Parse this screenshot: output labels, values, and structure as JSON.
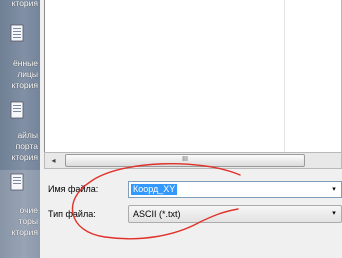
{
  "places": [
    {
      "label": "ктория",
      "icon": "folder-icon"
    },
    {
      "label": "ённые\nлицы\nктория",
      "icon": "document-icon"
    },
    {
      "label": "айлы\nпорта\nктория",
      "icon": "document-icon"
    },
    {
      "label": "очие\nторы\nктория",
      "icon": "document-icon"
    }
  ],
  "scrollbar": {
    "left_arrow": "◂",
    "thumb_grip": "III"
  },
  "filename": {
    "label": "Имя файла:",
    "value": "Коорд_XY",
    "dropdown_icon": "▾"
  },
  "filetype": {
    "label": "Тип файла:",
    "value": "ASCII (*.txt)",
    "dropdown_icon": "▾"
  },
  "colors": {
    "places_bg": "#7a8a9f",
    "selection": "#3399ff",
    "annotation": "#e0322a"
  }
}
